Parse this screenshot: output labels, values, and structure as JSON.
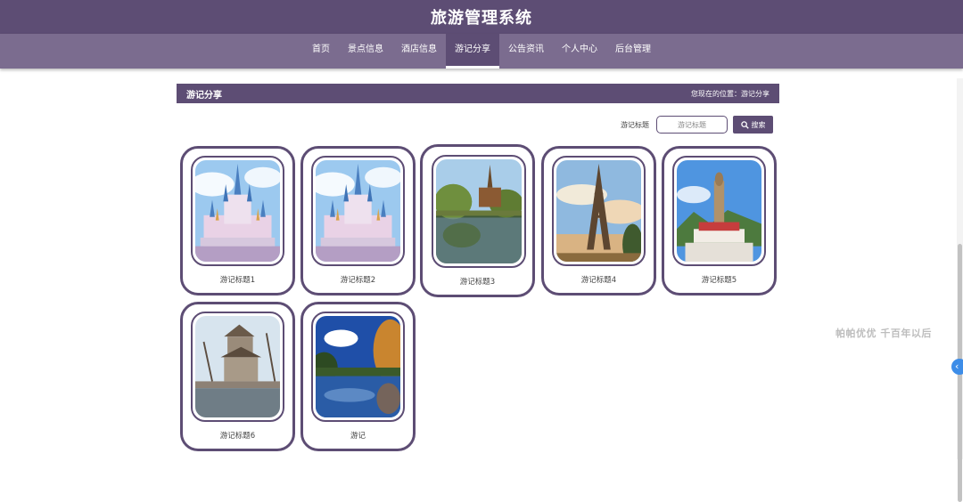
{
  "header": {
    "title": "旅游管理系统"
  },
  "nav": {
    "items": [
      {
        "label": "首页"
      },
      {
        "label": "景点信息"
      },
      {
        "label": "酒店信息"
      },
      {
        "label": "游记分享",
        "active": true
      },
      {
        "label": "公告资讯"
      },
      {
        "label": "个人中心"
      },
      {
        "label": "后台管理"
      }
    ]
  },
  "section": {
    "title": "游记分享",
    "breadcrumb": "您现在的位置：游记分享"
  },
  "search": {
    "label": "游记标题",
    "placeholder": "游记标题",
    "value": "",
    "button_label": "搜索",
    "button_icon": "search-icon"
  },
  "cards": [
    {
      "title": "游记标题1",
      "image": "castle-photo"
    },
    {
      "title": "游记标题2",
      "image": "castle-photo"
    },
    {
      "title": "游记标题3",
      "image": "pagoda-lake-photo"
    },
    {
      "title": "游记标题4",
      "image": "eiffel-tower-photo"
    },
    {
      "title": "游记标题5",
      "image": "buddha-statue-photo"
    },
    {
      "title": "游记标题6",
      "image": "tower-pavilion-photo"
    },
    {
      "title": "游记",
      "image": "autumn-lake-photo"
    }
  ],
  "watermark": "帕帕优优 千百年以后",
  "colors": {
    "primary": "#5d4d74",
    "nav": "#7b6c8f",
    "toggle": "#3d8de8"
  }
}
